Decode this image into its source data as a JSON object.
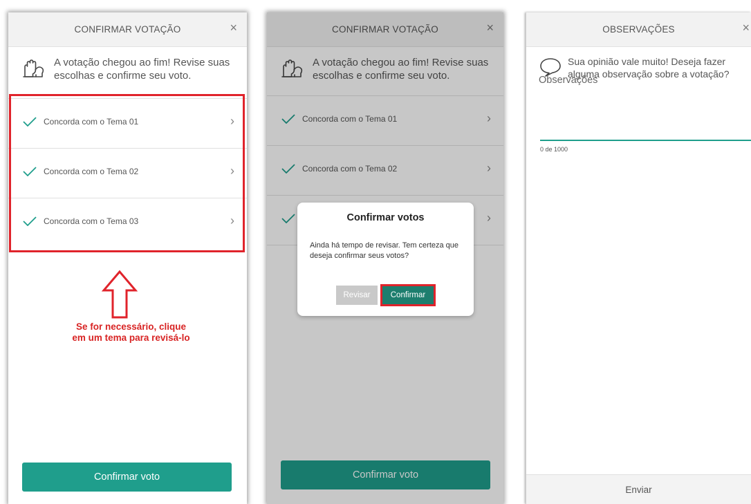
{
  "colors": {
    "accent": "#1f9e8c",
    "accent_dark": "#1d7e6e",
    "highlight": "#e0232b"
  },
  "screen1": {
    "header_title": "CONFIRMAR VOTAÇÃO",
    "close_icon": "×",
    "intro_text": "A votação chegou ao fim! Revise suas escolhas e confirme seu voto.",
    "items": [
      {
        "label": "Concorda com o Tema 01"
      },
      {
        "label": "Concorda com o Tema 02"
      },
      {
        "label": "Concorda com o Tema 03"
      }
    ],
    "chevron": "›",
    "annotation": "Se for necessário, clique em um tema para revisá-lo",
    "confirm_button": "Confirmar voto"
  },
  "screen2": {
    "header_title": "CONFIRMAR VOTAÇÃO",
    "close_icon": "×",
    "intro_text": "A votação chegou ao fim! Revise suas escolhas e confirme seu voto.",
    "items": [
      {
        "label": "Concorda com o Tema 01"
      },
      {
        "label": "Concorda com o Tema 02"
      }
    ],
    "chevron": "›",
    "dialog": {
      "title": "Confirmar votos",
      "message": "Ainda há tempo de revisar. Tem certeza que deseja confirmar seus votos?",
      "cancel": "Revisar",
      "confirm": "Confirmar"
    },
    "confirm_button": "Confirmar voto"
  },
  "screen3": {
    "header_title": "OBSERVAÇÕES",
    "close_icon": "×",
    "intro_text": "Sua opinião vale muito! Deseja fazer alguma observação sobre a votação?",
    "input_placeholder": "Observações",
    "counter": "0 de 1000",
    "send_button": "Enviar"
  }
}
